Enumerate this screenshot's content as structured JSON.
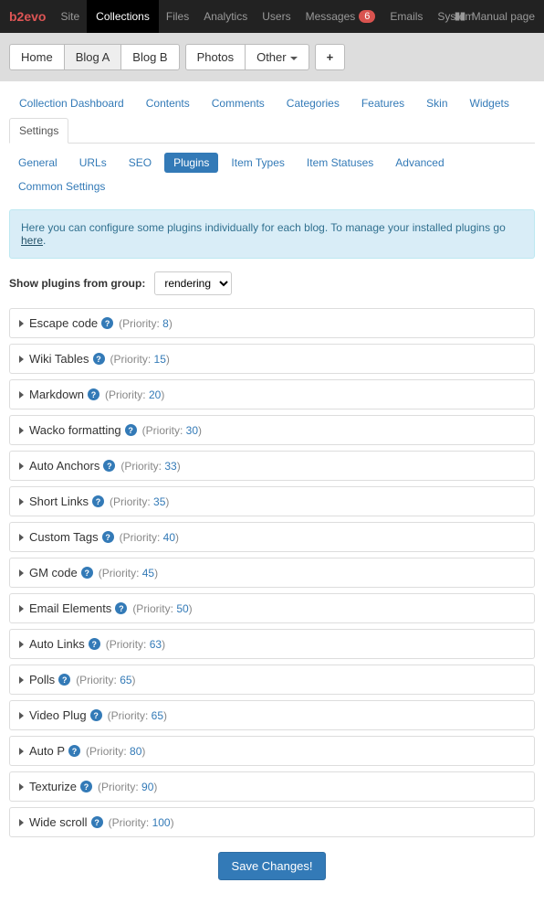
{
  "topnav": {
    "brand": "b2evo",
    "items": [
      {
        "label": "Site",
        "active": false
      },
      {
        "label": "Collections",
        "active": true
      },
      {
        "label": "Files",
        "active": false
      },
      {
        "label": "Analytics",
        "active": false
      },
      {
        "label": "Users",
        "active": false
      },
      {
        "label": "Messages",
        "badge": "6",
        "active": false
      },
      {
        "label": "Emails",
        "active": false
      },
      {
        "label": "System",
        "active": false
      }
    ],
    "manual": "Manual page"
  },
  "colltabs": [
    {
      "label": "Home",
      "active": false
    },
    {
      "label": "Blog A",
      "active": true
    },
    {
      "label": "Blog B",
      "active": false
    }
  ],
  "colltabs2": [
    {
      "label": "Photos"
    },
    {
      "label": "Other",
      "dropdown": true
    }
  ],
  "sectiontabs": [
    {
      "label": "Collection Dashboard"
    },
    {
      "label": "Contents"
    },
    {
      "label": "Comments"
    },
    {
      "label": "Categories"
    },
    {
      "label": "Features"
    },
    {
      "label": "Skin"
    },
    {
      "label": "Widgets"
    },
    {
      "label": "Settings",
      "active": true
    }
  ],
  "pills": [
    {
      "label": "General"
    },
    {
      "label": "URLs"
    },
    {
      "label": "SEO"
    },
    {
      "label": "Plugins",
      "active": true
    },
    {
      "label": "Item Types"
    },
    {
      "label": "Item Statuses"
    },
    {
      "label": "Advanced"
    },
    {
      "label": "Common Settings"
    }
  ],
  "alert": {
    "text": "Here you can configure some plugins individually for each blog. To manage your installed plugins go ",
    "link": "here",
    "suffix": "."
  },
  "filter": {
    "label": "Show plugins from group:",
    "value": "rendering"
  },
  "plugins": [
    {
      "name": "Escape code",
      "priority": "8"
    },
    {
      "name": "Wiki Tables",
      "priority": "15"
    },
    {
      "name": "Markdown",
      "priority": "20"
    },
    {
      "name": "Wacko formatting",
      "priority": "30"
    },
    {
      "name": "Auto Anchors",
      "priority": "33"
    },
    {
      "name": "Short Links",
      "priority": "35"
    },
    {
      "name": "Custom Tags",
      "priority": "40"
    },
    {
      "name": "GM code",
      "priority": "45"
    },
    {
      "name": "Email Elements",
      "priority": "50"
    },
    {
      "name": "Auto Links",
      "priority": "63"
    },
    {
      "name": "Polls",
      "priority": "65"
    },
    {
      "name": "Video Plug",
      "priority": "65"
    },
    {
      "name": "Auto P",
      "priority": "80"
    },
    {
      "name": "Texturize",
      "priority": "90"
    },
    {
      "name": "Wide scroll",
      "priority": "100"
    }
  ],
  "save": "Save Changes!",
  "priority_label": "Priority"
}
